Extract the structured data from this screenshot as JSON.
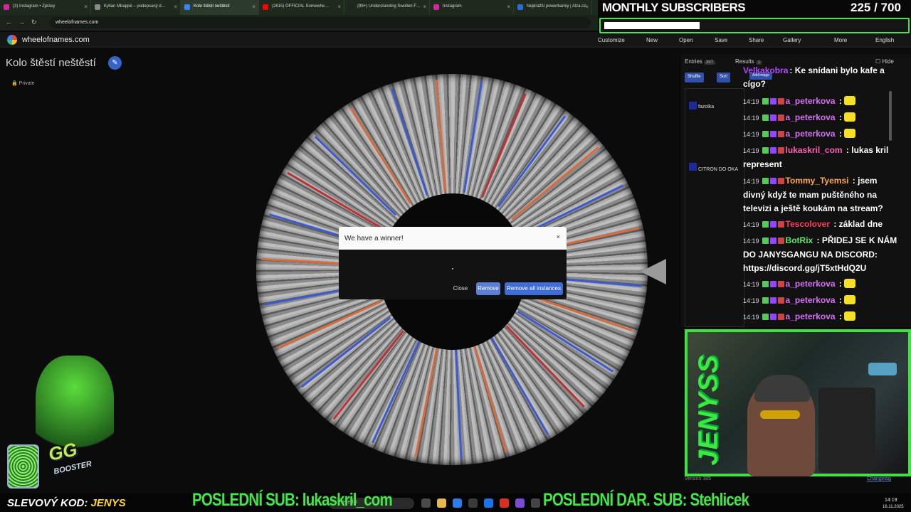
{
  "browser": {
    "tabs": [
      {
        "label": "(3) Instagram • Zprávy",
        "color": "#d6249f"
      },
      {
        "label": "Kylian Mbappé – podepsaný d…",
        "color": "#888888"
      },
      {
        "label": "Kolo štěstí neštěstí",
        "color": "#3b82f6",
        "active": true
      },
      {
        "label": "(2615) OFFICIAL Somewhe…",
        "color": "#ff0000"
      },
      {
        "label": "(99+) Understanding Swollen F…",
        "color": "#222222"
      },
      {
        "label": "Instagram",
        "color": "#d6249f"
      },
      {
        "label": "Nejdražší powerbanky | Alza.cz",
        "color": "#2d6ae0"
      }
    ],
    "url": "wheelofnames.com"
  },
  "site": {
    "name": "wheelofnames.com",
    "menu": [
      "Customize",
      "New",
      "Open",
      "Save",
      "Share",
      "Gallery",
      "More",
      "English"
    ]
  },
  "page": {
    "title": "Kolo štěstí neštěstí",
    "visibility": "Private"
  },
  "dialog": {
    "title": "We have a winner!",
    "close_x": "×",
    "winner": "",
    "buttons": {
      "close": "Close",
      "remove": "Remove",
      "remove_all": "Remove all instances"
    }
  },
  "entries_panel": {
    "tabs": [
      {
        "label": "Entries",
        "count": "397"
      },
      {
        "label": "Results",
        "count": "1"
      }
    ],
    "hide_label": "Hide",
    "buttons": [
      "Shuffle",
      "Sort",
      "Add image"
    ],
    "entries": [
      "fazolka",
      "CITRON DO OKA"
    ]
  },
  "chat": {
    "messages": [
      {
        "time": "",
        "user": "Velkakobra",
        "user_color": "#b24cff",
        "text": ": Ke snídani bylo kafe a cígo?"
      },
      {
        "time": "14:19",
        "user": "a_peterkova",
        "user_color": "#d66ef5",
        "text": " : ",
        "emote": true
      },
      {
        "time": "14:19",
        "user": "a_peterkova",
        "user_color": "#d66ef5",
        "text": " : ",
        "emote": true
      },
      {
        "time": "14:19",
        "user": "a_peterkova",
        "user_color": "#d66ef5",
        "text": " : ",
        "emote": true
      },
      {
        "time": "14:19",
        "user": "lukaskril_com",
        "user_color": "#ff5fb8",
        "text": " : lukas kril represent"
      },
      {
        "time": "14:19",
        "user": "Tommy_Tyemsi",
        "user_color": "#ffa94d",
        "text": " : jsem divný když te mam puštěného na televizi a ještě koukám na stream?"
      },
      {
        "time": "14:19",
        "user": "Tescolover",
        "user_color": "#ff3b5c",
        "text": " : základ dne"
      },
      {
        "time": "14:19",
        "user": "BotRix",
        "user_color": "#5de86a",
        "text": " : PŘIDEJ SE K NÁM DO JANYSGANGU NA DISCORD: https://discord.gg/jT5xtHdQ2U"
      },
      {
        "time": "14:19",
        "user": "a_peterkova",
        "user_color": "#d66ef5",
        "text": " : ",
        "emote": true
      },
      {
        "time": "14:19",
        "user": "a_peterkova",
        "user_color": "#d66ef5",
        "text": " : ",
        "emote": true
      },
      {
        "time": "14:19",
        "user": "a_peterkova",
        "user_color": "#d66ef5",
        "text": " : ",
        "emote": true
      }
    ]
  },
  "overlay": {
    "subs_title": "MONTHLY SUBSCRIBERS",
    "subs_count": "225 / 700",
    "subs_progress": 0.32,
    "streamer_tag": "JENYSS",
    "booster_text": "GG",
    "booster_sub": "BOOSTER",
    "promo_prefix": "SLEVOVÝ KOD:",
    "promo_code": "JENYS",
    "last_sub": "POSLEDNÍ SUB: lukaskril_com",
    "last_gift": "POSLEDNÍ DAR. SUB: Stehlicek"
  },
  "footer": {
    "version": "Version 385",
    "changelog": "Changelog"
  },
  "taskbar": {
    "search_placeholder": "Hledat",
    "time": "14:19",
    "date": "16.11.2025"
  },
  "colors": {
    "accent_green": "#41e146",
    "dialog_button": "#3f6dd8",
    "edit_button": "#3565c8"
  }
}
